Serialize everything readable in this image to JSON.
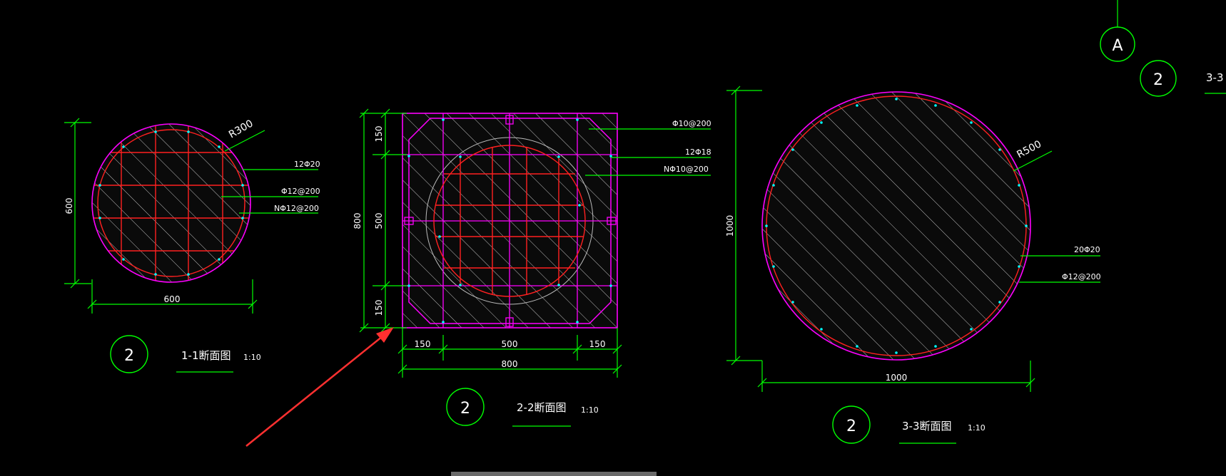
{
  "colors": {
    "background": "#000000",
    "concrete_outline": "#ff00ff",
    "rebar": "#ff2020",
    "dimension": "#00ff00",
    "text": "#ffffff",
    "hatch": "#c8c8c8",
    "bar_dots": "#00ffff",
    "arrow": "#ff3030"
  },
  "grid_bubble": {
    "label": "A"
  },
  "section_1": {
    "radius_label": "R300",
    "width_dim": "600",
    "height_dim": "600",
    "labels": {
      "main": "12Φ20",
      "stirrup": "Φ12@200",
      "tie": "NΦ12@200"
    },
    "bubble": "2",
    "title": "1-1断面图",
    "scale": "1:10"
  },
  "section_2": {
    "dims_left": [
      "150",
      "500",
      "150"
    ],
    "height_total": "800",
    "dims_bottom": [
      "150",
      "500",
      "150"
    ],
    "width_total": "800",
    "labels": {
      "stirrup": "Φ10@200",
      "main": "12Φ18",
      "tie": "NΦ10@200"
    },
    "bubble": "2",
    "title": "2-2断面图",
    "scale": "1:10"
  },
  "section_3": {
    "radius_label": "R500",
    "width_dim": "1000",
    "height_dim": "1000",
    "labels": {
      "main": "20Φ20",
      "stirrup": "Φ12@200"
    },
    "bubble": "2",
    "title": "3-3断面图",
    "scale": "1:10"
  },
  "section_partial": {
    "bubble": "2",
    "title_fragment": "3-3"
  }
}
